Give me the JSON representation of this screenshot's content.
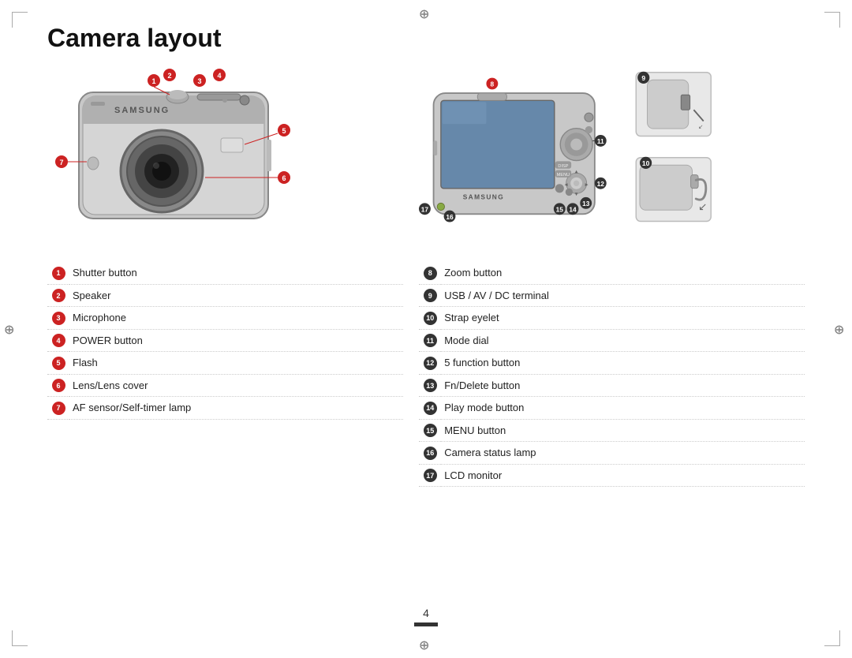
{
  "page": {
    "title": "Camera layout",
    "page_number": "4"
  },
  "left_parts": [
    {
      "number": "1",
      "label": "Shutter button"
    },
    {
      "number": "2",
      "label": "Speaker"
    },
    {
      "number": "3",
      "label": "Microphone"
    },
    {
      "number": "4",
      "label": "POWER button"
    },
    {
      "number": "5",
      "label": "Flash"
    },
    {
      "number": "6",
      "label": "Lens/Lens cover"
    },
    {
      "number": "7",
      "label": "AF sensor/Self-timer lamp"
    }
  ],
  "right_parts": [
    {
      "number": "8",
      "label": "Zoom button"
    },
    {
      "number": "9",
      "label": "USB / AV / DC terminal"
    },
    {
      "number": "10",
      "label": "Strap eyelet"
    },
    {
      "number": "11",
      "label": "Mode dial"
    },
    {
      "number": "12",
      "label": "5 function button"
    },
    {
      "number": "13",
      "label": "Fn/Delete button"
    },
    {
      "number": "14",
      "label": "Play mode button"
    },
    {
      "number": "15",
      "label": "MENU button"
    },
    {
      "number": "16",
      "label": "Camera status lamp"
    },
    {
      "number": "17",
      "label": "LCD monitor"
    }
  ]
}
